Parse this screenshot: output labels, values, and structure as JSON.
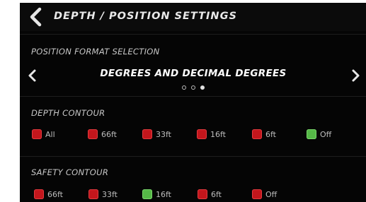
{
  "header": {
    "title": "DEPTH / POSITION SETTINGS"
  },
  "position_format": {
    "section_label": "POSITION FORMAT SELECTION",
    "value": "DEGREES AND DECIMAL DEGREES",
    "page_count": 3,
    "active_page": 3
  },
  "depth_contour": {
    "section_label": "DEPTH CONTOUR",
    "options": [
      {
        "label": "All",
        "selected": false
      },
      {
        "label": "66ft",
        "selected": false
      },
      {
        "label": "33ft",
        "selected": false
      },
      {
        "label": "16ft",
        "selected": false
      },
      {
        "label": "6ft",
        "selected": false
      },
      {
        "label": "Off",
        "selected": true
      }
    ]
  },
  "safety_contour": {
    "section_label": "SAFETY CONTOUR",
    "options": [
      {
        "label": "66ft",
        "selected": false
      },
      {
        "label": "33ft",
        "selected": false
      },
      {
        "label": "16ft",
        "selected": true
      },
      {
        "label": "6ft",
        "selected": false
      },
      {
        "label": "Off",
        "selected": false
      }
    ]
  },
  "colors": {
    "background": "#050505",
    "unselected": "#c3161c",
    "selected": "#55b847",
    "text": "#d8d8d8"
  },
  "icons": {
    "back": "chevron-left-icon",
    "prev": "chevron-left-icon",
    "next": "chevron-right-icon"
  }
}
